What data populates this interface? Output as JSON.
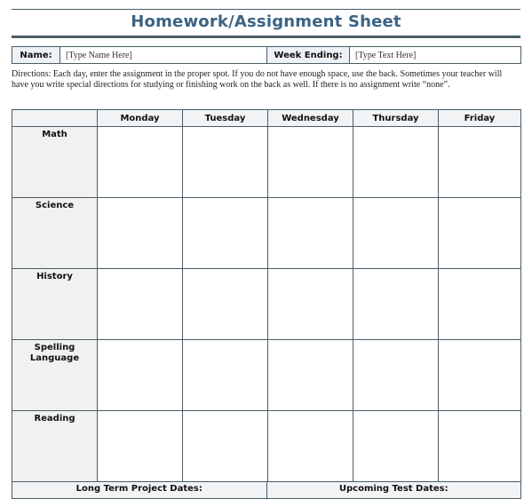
{
  "document": {
    "title": "Homework/Assignment Sheet",
    "name_label": "Name:",
    "name_value": "[Type Name Here]",
    "week_label": "Week Ending:",
    "week_value": "[Type Text Here]",
    "directions": "Directions: Each day, enter the assignment in the proper spot. If you do not have enough space, use the back. Sometimes your teacher will have you write special directions for studying or finishing work on the back as well. If there is no assignment write “none”.",
    "days": [
      "Monday",
      "Tuesday",
      "Wednesday",
      "Thursday",
      "Friday"
    ],
    "subjects": [
      "Math",
      "Science",
      "History",
      "Spelling\nLanguage",
      "Reading"
    ],
    "subject_lines": [
      [
        "Math"
      ],
      [
        "Science"
      ],
      [
        "History"
      ],
      [
        "Spelling",
        "Language"
      ],
      [
        "Reading"
      ]
    ],
    "long_term_label": "Long Term Project Dates:",
    "upcoming_tests_label": "Upcoming Test Dates:"
  }
}
